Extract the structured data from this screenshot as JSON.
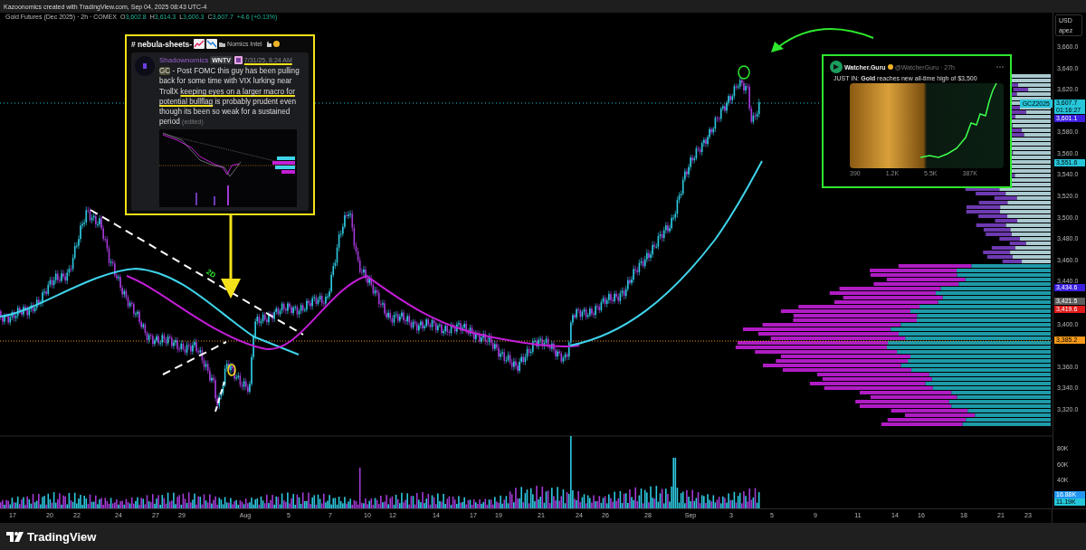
{
  "header": {
    "text": "Kazoonomics created with TradingView.com, Sep 04, 2025 08:43 UTC-4"
  },
  "legend": {
    "symbol": "Gold Futures (Dec 2025) · 2h · COMEX",
    "ohlc": [
      {
        "label": "O",
        "value": "3,602.8"
      },
      {
        "label": "H",
        "value": "3,614.3"
      },
      {
        "label": "L",
        "value": "3,600.3"
      },
      {
        "label": "C",
        "value": "3,607.7"
      }
    ],
    "change": "+4.6 (+0.13%)"
  },
  "currency_box": {
    "currency": "USD",
    "label": "apez"
  },
  "price_axis": {
    "ticks": [
      "3,660.0",
      "3,640.0",
      "3,620.0",
      "3,580.0",
      "3,560.0",
      "3,540.0",
      "3,520.0",
      "3,500.0",
      "3,480.0",
      "3,460.0",
      "3,440.0",
      "3,400.0",
      "3,360.0",
      "3,340.0",
      "3,320.0"
    ],
    "tags": [
      {
        "text": "3,607.7",
        "sub": "01:16:27",
        "color": "#26c6da"
      },
      {
        "text": "3,601.1",
        "color": "#3b1fe0"
      },
      {
        "text": "3,551.6",
        "color": "#26c6da"
      },
      {
        "text": "3,434.6",
        "color": "#3b1fe0"
      },
      {
        "text": "3,421.5",
        "color": "#5d5d5d"
      },
      {
        "text": "3,419.6",
        "color": "#e01a1a"
      },
      {
        "text": "3,385.2",
        "color": "#f59a1a"
      }
    ]
  },
  "symbol_tag": {
    "text": "GCZ2025",
    "color": "#26c6da"
  },
  "volume_axis": {
    "ticks": [
      "80K",
      "60K",
      "40K"
    ],
    "tags": [
      {
        "text": "16.88K",
        "color": "#2196f3"
      },
      {
        "text": "11.19K",
        "color": "#26c6da"
      }
    ]
  },
  "time_axis": {
    "labels": [
      "17",
      "20",
      "22",
      "24",
      "27",
      "29",
      "Aug",
      "5",
      "7",
      "10",
      "12",
      "14",
      "17",
      "19",
      "21",
      "24",
      "26",
      "28",
      "Sep",
      "3",
      "5",
      "9",
      "11",
      "14",
      "16",
      "18",
      "21",
      "23"
    ]
  },
  "annotations": {
    "timeframe_label": "2D"
  },
  "discord_post": {
    "channel": "# nebula-sheets-",
    "server": "Nomics Intel",
    "author": "Shadownomics",
    "badge": "WNTV",
    "timestamp": "7/31/25, 8:24 AM",
    "body": [
      {
        "text": "GC",
        "highlighted": true,
        "underlined": false
      },
      {
        "text": " - Post FOMC this guy has been pulling back for some time with VIX lurking near TrollX ",
        "highlighted": false,
        "underlined": false
      },
      {
        "text": "keeping eyes on a larger macro for potential bullflag",
        "highlighted": false,
        "underlined": true
      },
      {
        "text": " is probably prudent even though its been so weak for a sustained period",
        "highlighted": false,
        "underlined": false
      }
    ],
    "edited": "(edited)"
  },
  "tweet": {
    "name": "Watcher.Guru",
    "handle": "@WatcherGuru · 27h",
    "text": "JUST IN: **Gold** reaches new all-time high of $3,500",
    "stats": [
      "390",
      "1.2K",
      "5.5K",
      "387K"
    ]
  },
  "footer": {
    "brand": "TradingView"
  }
}
